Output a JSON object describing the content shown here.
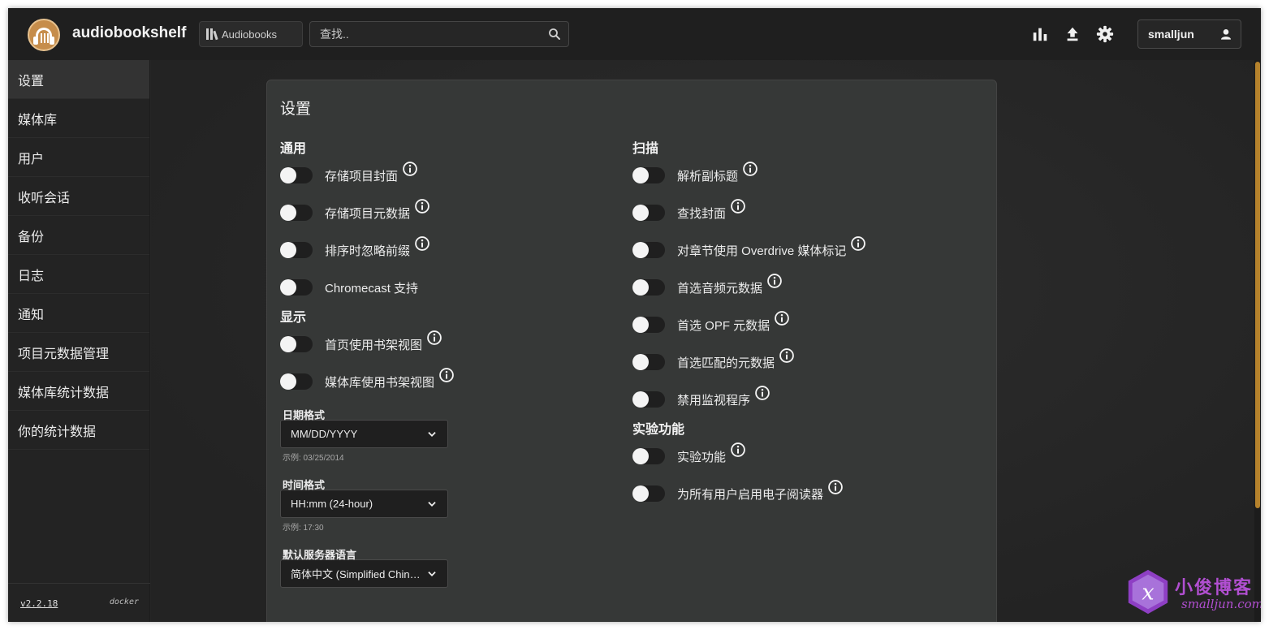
{
  "app": {
    "title": "audiobookshelf"
  },
  "header": {
    "library_button": "Audiobooks",
    "search_placeholder": "查找..",
    "username": "smalljun"
  },
  "sidebar": {
    "items": [
      "设置",
      "媒体库",
      "用户",
      "收听会话",
      "备份",
      "日志",
      "通知",
      "项目元数据管理",
      "媒体库统计数据",
      "你的统计数据"
    ],
    "version": "v2.2.18",
    "source": "docker"
  },
  "settings": {
    "title": "设置",
    "general": {
      "heading": "通用",
      "items": [
        {
          "label": "存储项目封面",
          "on": false,
          "info": true
        },
        {
          "label": "存储项目元数据",
          "on": false,
          "info": true
        },
        {
          "label": "排序时忽略前缀",
          "on": false,
          "info": true
        },
        {
          "label": "Chromecast 支持",
          "on": false,
          "info": false
        }
      ]
    },
    "display": {
      "heading": "显示",
      "items": [
        {
          "label": "首页使用书架视图",
          "on": false,
          "info": true
        },
        {
          "label": "媒体库使用书架视图",
          "on": false,
          "info": true
        }
      ],
      "date_format": {
        "label": "日期格式",
        "value": "MM/DD/YYYY",
        "hint": "示例: 03/25/2014"
      },
      "time_format": {
        "label": "时间格式",
        "value": "HH:mm (24-hour)",
        "hint": "示例: 17:30"
      },
      "language": {
        "label": "默认服务器语言",
        "value": "简体中文 (Simplified Chinese)"
      }
    },
    "scanner": {
      "heading": "扫描",
      "items": [
        {
          "label": "解析副标题",
          "on": false,
          "info": true
        },
        {
          "label": "查找封面",
          "on": false,
          "info": true
        },
        {
          "label": "对章节使用 Overdrive 媒体标记",
          "on": false,
          "info": true
        },
        {
          "label": "首选音频元数据",
          "on": false,
          "info": true
        },
        {
          "label": "首选 OPF 元数据",
          "on": false,
          "info": true
        },
        {
          "label": "首选匹配的元数据",
          "on": false,
          "info": true
        },
        {
          "label": "禁用监视程序",
          "on": false,
          "info": true
        }
      ]
    },
    "experimental": {
      "heading": "实验功能",
      "items": [
        {
          "label": "实验功能",
          "on": false,
          "info": true
        },
        {
          "label": "为所有用户启用电子阅读器",
          "on": false,
          "info": true
        }
      ]
    }
  },
  "watermark": {
    "cn": "小俊博客",
    "en": "smalljun.com"
  },
  "colors": {
    "accent": "#c68d4b",
    "scroll": "#b5822c",
    "watermark": "#b14fd1"
  }
}
